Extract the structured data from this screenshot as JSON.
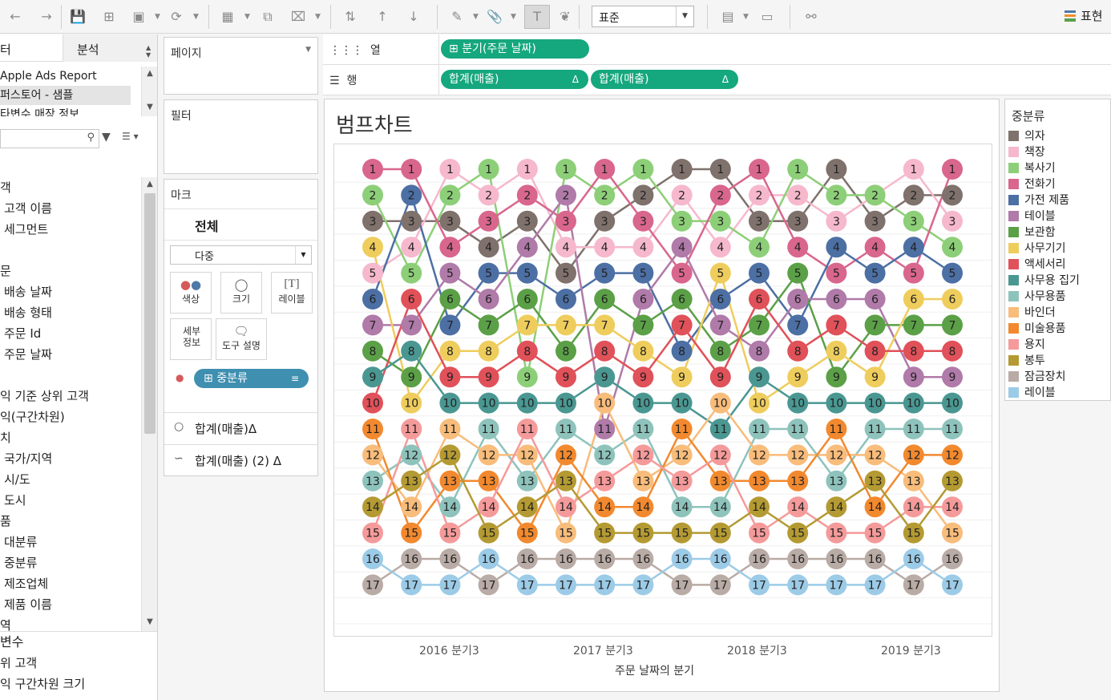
{
  "toolbar": {
    "fit": "표준",
    "show_me_label": "표현"
  },
  "data_pane": {
    "tab_data": "터",
    "tab_analytics": "분석",
    "datasources": [
      "Apple Ads Report",
      "퍼스토어 - 샘플",
      "타변수 매장 정보"
    ],
    "fields": [
      {
        "label": "객",
        "kind": "folder"
      },
      {
        "label": "고객 이름",
        "kind": "child"
      },
      {
        "label": "세그먼트",
        "kind": "child"
      },
      {
        "label": "",
        "kind": "gap"
      },
      {
        "label": "문",
        "kind": "folder"
      },
      {
        "label": "배송 날짜",
        "kind": "child"
      },
      {
        "label": "배송 형태",
        "kind": "child"
      },
      {
        "label": "주문 Id",
        "kind": "child"
      },
      {
        "label": "주문 날짜",
        "kind": "child"
      },
      {
        "label": "",
        "kind": "gap"
      },
      {
        "label": "익 기준 상위 고객",
        "kind": "folder"
      },
      {
        "label": "익(구간차원)",
        "kind": "folder"
      },
      {
        "label": "치",
        "kind": "folder"
      },
      {
        "label": "국가/지역",
        "kind": "child"
      },
      {
        "label": "시/도",
        "kind": "child"
      },
      {
        "label": "도시",
        "kind": "child"
      },
      {
        "label": "품",
        "kind": "folder"
      },
      {
        "label": "대분류",
        "kind": "child"
      },
      {
        "label": "중분류",
        "kind": "child"
      },
      {
        "label": "제조업체",
        "kind": "child"
      },
      {
        "label": "제품 이름",
        "kind": "child"
      },
      {
        "label": "역",
        "kind": "folder"
      }
    ],
    "params_header": "변수",
    "params": [
      "위 고객",
      "익 구간차원 크기"
    ]
  },
  "shelves": {
    "pages_title": "페이지",
    "filters_title": "필터",
    "marks_title": "마크",
    "marks_all": "전체",
    "mark_type": "다중",
    "buttons": {
      "color": "색상",
      "size": "크기",
      "label": "레이블",
      "detail": "세부 정보",
      "tooltip": "도구 설명"
    },
    "color_pill": "중분류",
    "measure_1": "합계(매출)",
    "measure_2": "합계(매출) (2)",
    "delta": "Δ",
    "columns_label": "열",
    "rows_label": "행",
    "columns_pill": "분기(주문 날짜)",
    "rows_pill_1": "합계(매출)",
    "rows_pill_2": "합계(매출)"
  },
  "view": {
    "title": "범프차트",
    "x_title": "주문 날짜의 분기",
    "x_ticks": [
      "2016 분기3",
      "2017 분기3",
      "2018 분기3",
      "2019 분기3"
    ]
  },
  "chart_data": {
    "type": "line",
    "title": "범프차트",
    "xlabel": "주문 날짜의 분기",
    "ylabel": "",
    "x": [
      "2016 Q1",
      "2016 Q2",
      "2016 Q3",
      "2016 Q4",
      "2017 Q1",
      "2017 Q2",
      "2017 Q3",
      "2017 Q4",
      "2018 Q1",
      "2018 Q2",
      "2018 Q3",
      "2018 Q4",
      "2019 Q1",
      "2019 Q2",
      "2019 Q3",
      "2019 Q4"
    ],
    "x_tick_labels": [
      "2016 분기3",
      "2017 분기3",
      "2018 분기3",
      "2019 분기3"
    ],
    "y_reversed": true,
    "ylim": [
      1,
      17
    ],
    "series": [
      {
        "name": "의자",
        "color": "#7f716b",
        "values": [
          3,
          3,
          3,
          4,
          3,
          5,
          3,
          2,
          1,
          1,
          3,
          3,
          1,
          3,
          2,
          2
        ]
      },
      {
        "name": "책장",
        "color": "#f6b8cc",
        "values": [
          5,
          4,
          1,
          2,
          1,
          4,
          4,
          4,
          2,
          4,
          2,
          2,
          3,
          2,
          1,
          3
        ]
      },
      {
        "name": "복사기",
        "color": "#8dcf78",
        "values": [
          2,
          5,
          2,
          1,
          9,
          1,
          2,
          1,
          3,
          3,
          4,
          1,
          2,
          2,
          3,
          4
        ]
      },
      {
        "name": "전화기",
        "color": "#d9668d",
        "values": [
          1,
          1,
          4,
          3,
          2,
          3,
          1,
          3,
          5,
          2,
          1,
          4,
          5,
          4,
          5,
          1
        ]
      },
      {
        "name": "가전 제품",
        "color": "#4c6fa4",
        "values": [
          6,
          2,
          7,
          5,
          5,
          6,
          5,
          5,
          8,
          6,
          5,
          7,
          4,
          5,
          4,
          5
        ]
      },
      {
        "name": "테이블",
        "color": "#b07aa9",
        "values": [
          7,
          7,
          5,
          6,
          4,
          2,
          11,
          6,
          4,
          7,
          8,
          6,
          6,
          6,
          9,
          9
        ]
      },
      {
        "name": "보관함",
        "color": "#5ba047",
        "values": [
          8,
          9,
          6,
          7,
          6,
          8,
          6,
          7,
          6,
          8,
          7,
          5,
          9,
          7,
          7,
          7
        ]
      },
      {
        "name": "사무기기",
        "color": "#efcd5d",
        "values": [
          4,
          10,
          8,
          8,
          7,
          7,
          7,
          8,
          9,
          5,
          10,
          9,
          8,
          9,
          6,
          6
        ]
      },
      {
        "name": "액세서리",
        "color": "#e05159",
        "values": [
          10,
          6,
          9,
          9,
          8,
          9,
          8,
          9,
          7,
          9,
          6,
          8,
          7,
          8,
          8,
          8
        ]
      },
      {
        "name": "사무용 집기",
        "color": "#4a9792",
        "values": [
          9,
          8,
          10,
          10,
          10,
          10,
          9,
          10,
          10,
          11,
          9,
          10,
          10,
          10,
          10,
          10
        ]
      },
      {
        "name": "사무용품",
        "color": "#8ec3bc",
        "values": [
          13,
          12,
          14,
          11,
          13,
          11,
          12,
          11,
          14,
          14,
          11,
          11,
          13,
          11,
          11,
          11
        ]
      },
      {
        "name": "바인더",
        "color": "#f8bc7b",
        "values": [
          12,
          14,
          11,
          12,
          12,
          15,
          10,
          13,
          12,
          10,
          12,
          12,
          12,
          12,
          13,
          15
        ]
      },
      {
        "name": "미술용품",
        "color": "#f2892e",
        "values": [
          11,
          15,
          13,
          13,
          15,
          12,
          14,
          14,
          11,
          13,
          13,
          13,
          11,
          14,
          12,
          12
        ]
      },
      {
        "name": "용지",
        "color": "#f59a9a",
        "values": [
          15,
          11,
          15,
          14,
          11,
          14,
          13,
          12,
          13,
          12,
          15,
          14,
          15,
          15,
          14,
          14
        ]
      },
      {
        "name": "봉투",
        "color": "#b49a32",
        "values": [
          14,
          13,
          12,
          15,
          14,
          13,
          15,
          15,
          15,
          15,
          14,
          15,
          14,
          13,
          15,
          13
        ]
      },
      {
        "name": "잠금장치",
        "color": "#b9aba5",
        "values": [
          17,
          16,
          16,
          17,
          16,
          16,
          16,
          16,
          17,
          17,
          16,
          16,
          16,
          16,
          17,
          16
        ]
      },
      {
        "name": "레이블",
        "color": "#9ccbe7",
        "values": [
          16,
          17,
          17,
          16,
          17,
          17,
          17,
          17,
          16,
          16,
          17,
          17,
          17,
          17,
          16,
          17
        ]
      }
    ],
    "grid": true,
    "legend": "right"
  },
  "legend": {
    "title": "중분류"
  }
}
